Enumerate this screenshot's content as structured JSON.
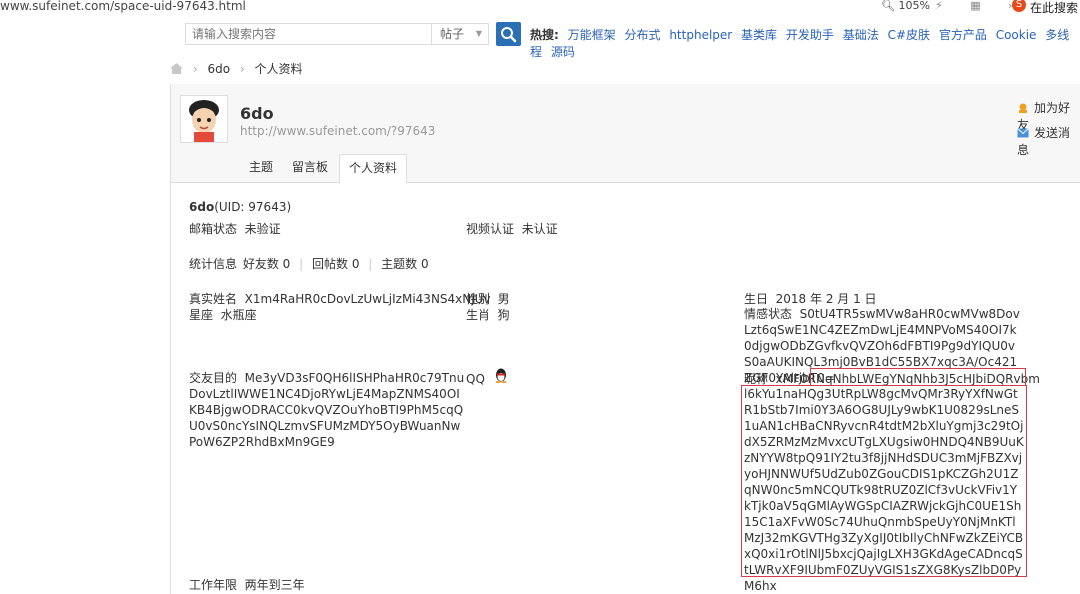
{
  "browser": {
    "url": "www.sufeinet.com/space-uid-97643.html",
    "zoom": "105%",
    "toolbar_icons": "⚡ ▦ ›",
    "sogou_label": "S",
    "search_text": "在此搜索"
  },
  "search": {
    "placeholder": "请输入搜索内容",
    "type": "帖子",
    "hot_label": "热搜:",
    "hot_links": [
      "万能框架",
      "分布式",
      "httphelper",
      "基类库",
      "开发助手",
      "基础法",
      "C#皮肤",
      "官方产品",
      "Cookie",
      "多线程",
      "源码"
    ]
  },
  "breadcrumb": {
    "home_icon": "home-icon",
    "items": [
      "6do",
      "个人资料"
    ]
  },
  "profile": {
    "username": "6do",
    "url": "http://www.sufeinet.com/?97643",
    "tabs": [
      "主题",
      "留言板",
      "个人资料"
    ],
    "active_tab": "个人资料",
    "side_links": [
      "加为好友",
      "发送消息"
    ]
  },
  "details": {
    "name_label": "6do",
    "uid": "(UID: 97643)",
    "email_status_label": "邮箱状态",
    "email_status": "未验证",
    "video_label": "视频认证",
    "video_status": "未认证",
    "stats_label": "统计信息",
    "friends": "好友数 0",
    "replies": "回帖数 0",
    "threads": "主题数 0",
    "realname_label": "真实姓名",
    "realname": "X1m4RaHR0cDovLzUwLjIzMi43NS4xNjUv",
    "gender_label": "性别",
    "gender": "男",
    "constellation_label": "星座",
    "constellation": "水瓶座",
    "zodiac_label": "生肖",
    "zodiac": "狗",
    "purpose_label": "交友目的",
    "purpose": "Me3yVD3sF0QH6lISHPhaHR0c79TnuDovLztlIWWE1NC4DjoRYwLjE4MapZNMS40OIKB4BjgwODRACC0kvQVZOuYhoBTI9PhM5cqQU0vS0ncYsINQLzmvSFUMzMDY5OyBWuanNwPoW6ZP2RhdBxMn9GE9",
    "qq_label": "QQ",
    "birthday_label": "生日",
    "birthday": "2018 年 2 月 1 日",
    "emotion_label": "情感状态",
    "emotion": "S0tU4TR5swMVw8aHR0cwMVw8DovLzt6qSwE1NC4ZEZmDwLjE4MNPVoMS40OI7k0djgwODbZGvfkvQVZOh6dFBTI9Pg9dYIQU0vS0aAUKINQL3mj0BvB1dC55BX7xqc3A/Oc421ZGF0YAltjbT0=",
    "nickname_label": "昵称",
    "nickname_head": "xMF0R",
    "nickname_boxed_line": "NqNhbLWEgYNqNhb3J5cHJbiDQRvbm",
    "nickname_boxed_rest": "l6kYu1naHQg3UtRpLW8gcMvQMr3RyYXfNwGtR1bStb7Imi0Y3A6OG8UJLy9wbK1U0829sLneS1uAN1cHBaCNRyvcnR4tdtM2bXluYgmj3c29tOjdX5ZRMzMzMvxcUTgLXUgsiw0HNDQ4NB9UuKzNYYW8tpQ91IY2tu3f8jjNHdSDUC3mMjFBZXvjyoHJNNWUf5UdZub0ZGouCDIS1pKCZGh2U1ZqNW0nc5mNCQUTk98tRUZ0ZlCf3vUckVFiv1YkTjk0aV5qGMlAyWGSpCIAZRWjckGjhC0UE1Sh15C1aXFvW0Sc74UhuQnmbSpeUyY0NjMnKTlMzJ32mKGVTHg3ZyXgIJ0tIbIlyChNFwZkZEiYCBxQ0xi1rOtlNlJ5bxcjQajIgLXH3GKdAgeCADncqStLWRvXF9IUbmF0ZUyVGIS1sZXG8KysZlbD0PyM6hx",
    "work_label": "工作年限",
    "work": "两年到三年"
  }
}
